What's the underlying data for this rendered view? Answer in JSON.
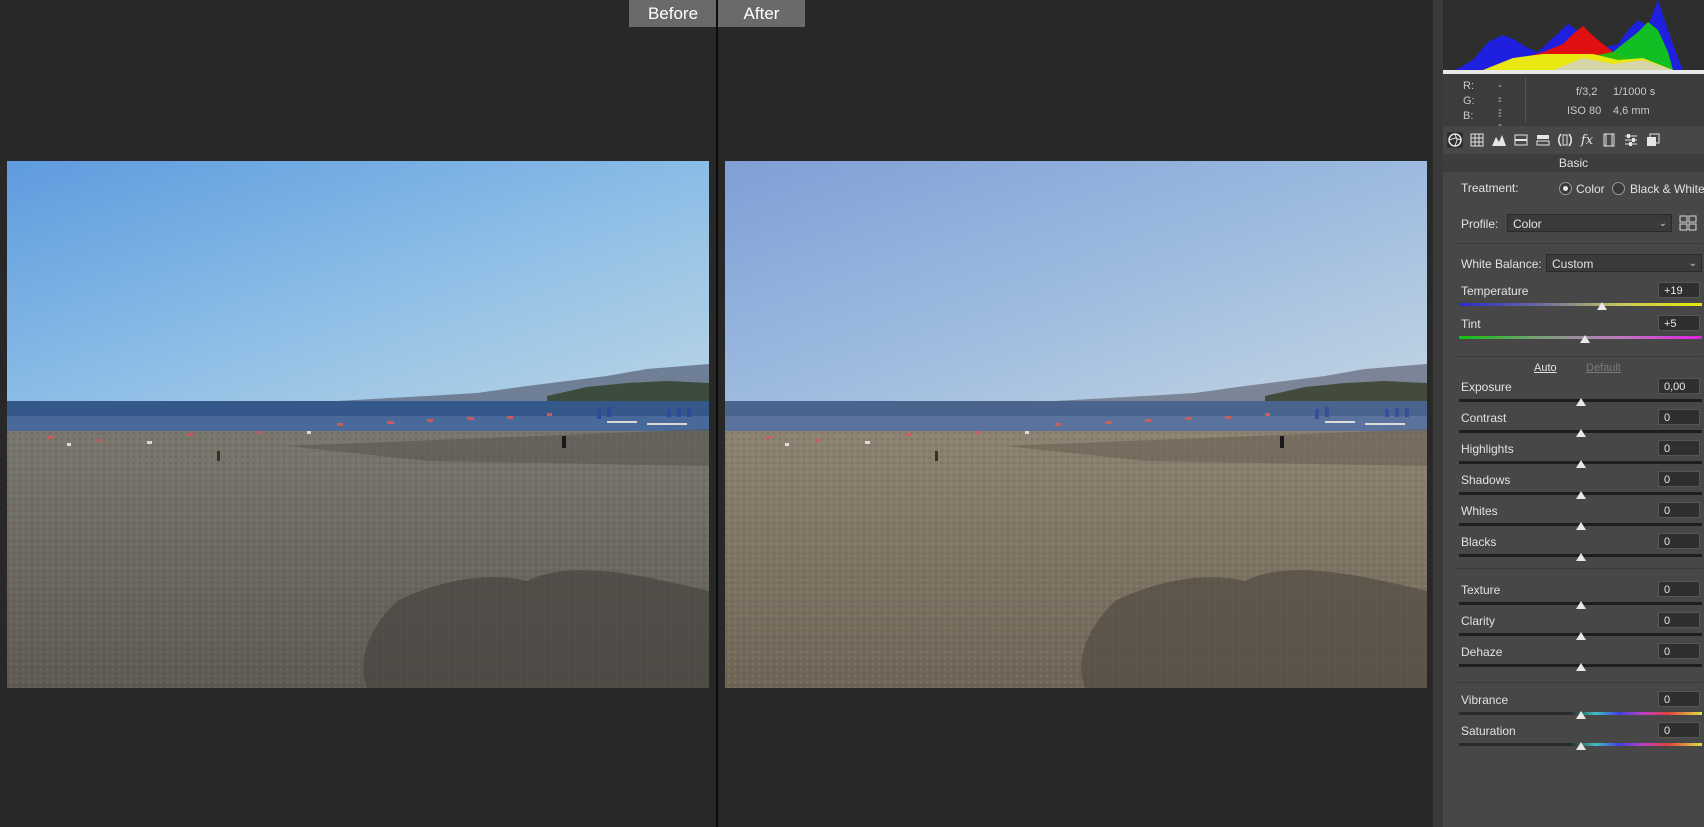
{
  "compare": {
    "before_label": "Before",
    "after_label": "After"
  },
  "histogram": {
    "channels": [
      "red",
      "green",
      "blue",
      "yellow"
    ]
  },
  "info": {
    "r_label": "R:",
    "r_value": "---",
    "g_label": "G:",
    "g_value": "---",
    "b_label": "B:",
    "b_value": "---",
    "aperture": "f/3,2",
    "shutter": "1/1000 s",
    "iso": "ISO 80",
    "focal_length": "4,6 mm"
  },
  "toolbar": {
    "icons": [
      "aperture-icon",
      "grid-icon",
      "mountains-icon",
      "split-toning-icon",
      "detail-icon",
      "lens-icon",
      "fx-icon",
      "film-icon",
      "sliders-icon",
      "snapshots-icon"
    ]
  },
  "basic": {
    "section_title": "Basic",
    "treatment_label": "Treatment:",
    "treatment_color": "Color",
    "treatment_bw": "Black & White",
    "profile_label": "Profile:",
    "profile_value": "Color",
    "wb_label": "White Balance:",
    "wb_value": "Custom",
    "auto_label": "Auto",
    "default_label": "Default",
    "sliders": {
      "temperature": {
        "label": "Temperature",
        "value": "+19",
        "pos": 0.59
      },
      "tint": {
        "label": "Tint",
        "value": "+5",
        "pos": 0.52
      },
      "exposure": {
        "label": "Exposure",
        "value": "0,00",
        "pos": 0.5
      },
      "contrast": {
        "label": "Contrast",
        "value": "0",
        "pos": 0.5
      },
      "highlights": {
        "label": "Highlights",
        "value": "0",
        "pos": 0.5
      },
      "shadows": {
        "label": "Shadows",
        "value": "0",
        "pos": 0.5
      },
      "whites": {
        "label": "Whites",
        "value": "0",
        "pos": 0.5
      },
      "blacks": {
        "label": "Blacks",
        "value": "0",
        "pos": 0.5
      },
      "texture": {
        "label": "Texture",
        "value": "0",
        "pos": 0.5
      },
      "clarity": {
        "label": "Clarity",
        "value": "0",
        "pos": 0.5
      },
      "dehaze": {
        "label": "Dehaze",
        "value": "0",
        "pos": 0.5
      },
      "vibrance": {
        "label": "Vibrance",
        "value": "0",
        "pos": 0.5
      },
      "saturation": {
        "label": "Saturation",
        "value": "0",
        "pos": 0.5
      }
    }
  },
  "colors": {
    "panel_bg": "#474747",
    "workspace_bg": "#282828",
    "tab_bg": "#6a6a6a"
  }
}
